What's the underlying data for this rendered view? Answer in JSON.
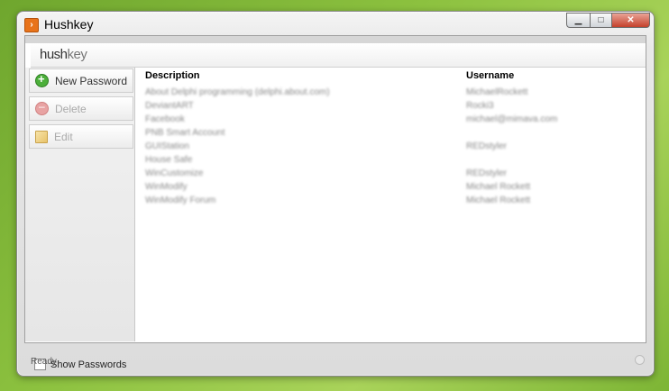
{
  "window": {
    "title": "Hushkey",
    "minimize": "▁",
    "maximize": "□",
    "close": "✕"
  },
  "brand": {
    "logo_a": "hush",
    "logo_b": "key"
  },
  "sidebar": {
    "new_label": "New Password",
    "delete_label": "Delete",
    "edit_label": "Edit",
    "show_passwords_label": "Show Passwords"
  },
  "table": {
    "columns": [
      "Description",
      "Username"
    ],
    "rows": [
      {
        "description": "About Delphi programming (delphi.about.com)",
        "username": "MichaelRockett"
      },
      {
        "description": "DeviantART",
        "username": "Rocki3"
      },
      {
        "description": "Facebook",
        "username": "michael@mimava.com"
      },
      {
        "description": "PNB Smart Account",
        "username": ""
      },
      {
        "description": "GUIStation",
        "username": "REDstyler"
      },
      {
        "description": "House Safe",
        "username": ""
      },
      {
        "description": "WinCustomize",
        "username": "REDstyler"
      },
      {
        "description": "WinModify",
        "username": "Michael Rockett"
      },
      {
        "description": "WinModify Forum",
        "username": "Michael Rockett"
      }
    ]
  },
  "status": {
    "text": "Ready"
  },
  "colors": {
    "accent": "#4caf3a",
    "desktop": "#8cc13f",
    "app_icon": "#e8731a"
  }
}
